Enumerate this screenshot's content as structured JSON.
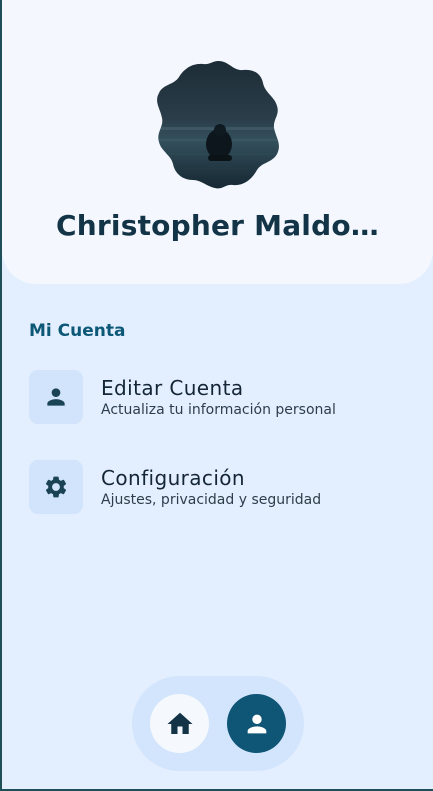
{
  "profile": {
    "name": "Christopher Maldo…"
  },
  "account": {
    "section_title": "Mi Cuenta",
    "items": [
      {
        "title": "Editar Cuenta",
        "subtitle": "Actualiza tu información personal",
        "icon": "person-icon"
      },
      {
        "title": "Configuración",
        "subtitle": "Ajustes, privacidad y seguridad",
        "icon": "gear-icon"
      }
    ]
  },
  "nav": {
    "items": [
      {
        "icon": "home-icon",
        "active": false
      },
      {
        "icon": "person-icon",
        "active": true
      }
    ]
  },
  "colors": {
    "background": "#e3efff",
    "header_card": "#f4f7fd",
    "accent": "#0f5676",
    "text_dark": "#123446",
    "icon_tile": "#d2e4fb"
  }
}
